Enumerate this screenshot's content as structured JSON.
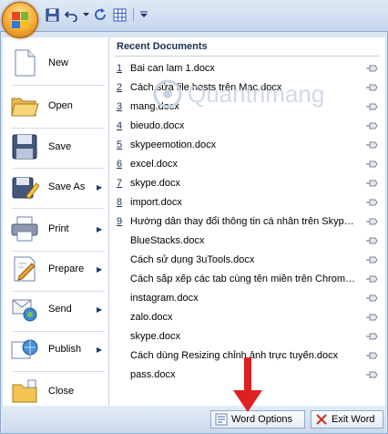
{
  "colors": {
    "accent": "#1f3b6a",
    "menu_bg": "#dbe6f4",
    "annotation": "#e02020"
  },
  "quick_access": {
    "icons": [
      "floppy-save-icon",
      "undo-icon",
      "repeat-icon",
      "table-icon",
      "customize-icon"
    ]
  },
  "left_menu": {
    "items": [
      {
        "label": "New",
        "has_arrow": false
      },
      {
        "label": "Open",
        "has_arrow": false
      },
      {
        "label": "Save",
        "has_arrow": false
      },
      {
        "label": "Save As",
        "has_arrow": true
      },
      {
        "label": "Print",
        "has_arrow": true
      },
      {
        "label": "Prepare",
        "has_arrow": true
      },
      {
        "label": "Send",
        "has_arrow": true
      },
      {
        "label": "Publish",
        "has_arrow": true
      },
      {
        "label": "Close",
        "has_arrow": false
      }
    ]
  },
  "recent": {
    "title": "Recent Documents",
    "watermark": "Quantrimang",
    "documents": [
      {
        "num": "1",
        "name": "Bai can lam 1.docx"
      },
      {
        "num": "2",
        "name": "Cách sửa file hosts trên Mac.docx"
      },
      {
        "num": "3",
        "name": "mang.docx"
      },
      {
        "num": "4",
        "name": "bieudo.docx"
      },
      {
        "num": "5",
        "name": "skypeemotion.docx"
      },
      {
        "num": "6",
        "name": "excel.docx"
      },
      {
        "num": "7",
        "name": "skype.docx"
      },
      {
        "num": "8",
        "name": "import.docx"
      },
      {
        "num": "9",
        "name": "Hướng dẫn thay đổi thông tin cá nhân trên Skype.docx"
      },
      {
        "num": "",
        "name": "BlueStacks.docx"
      },
      {
        "num": "",
        "name": "Cách sử dụng 3uTools.docx"
      },
      {
        "num": "",
        "name": "Cách sắp xếp các tab cùng tên miền trên Chrome.docx"
      },
      {
        "num": "",
        "name": "instagram.docx"
      },
      {
        "num": "",
        "name": "zalo.docx"
      },
      {
        "num": "",
        "name": "skype.docx"
      },
      {
        "num": "",
        "name": "Cách dùng Resizing chỉnh ảnh trực tuyến.docx"
      },
      {
        "num": "",
        "name": "pass.docx"
      }
    ]
  },
  "footer": {
    "word_options_label": "Word Options",
    "exit_word_label": "Exit Word"
  }
}
